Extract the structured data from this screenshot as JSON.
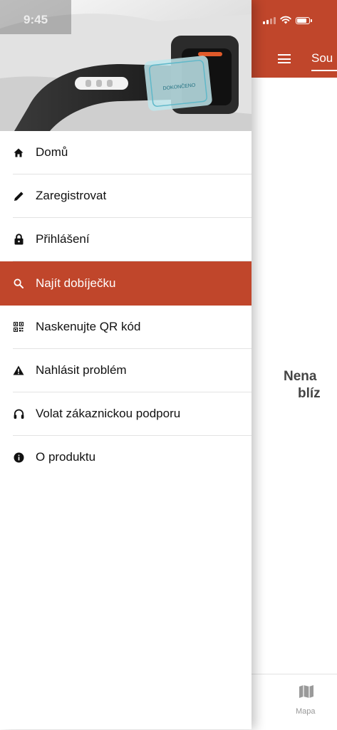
{
  "status_bar": {
    "time": "9:45"
  },
  "drawer": {
    "hero_screen_text": "DOKONČENO",
    "menu_items": [
      {
        "label": "Domů",
        "icon": "home-icon",
        "active": false
      },
      {
        "label": "Zaregistrovat",
        "icon": "pencil-icon",
        "active": false
      },
      {
        "label": "Přihlášení",
        "icon": "lock-icon",
        "active": false
      },
      {
        "label": "Najít dobíječku",
        "icon": "search-icon",
        "active": true
      },
      {
        "label": "Naskenujte QR kód",
        "icon": "qr-code-icon",
        "active": false
      },
      {
        "label": "Nahlásit problém",
        "icon": "warning-icon",
        "active": false
      },
      {
        "label": "Volat zákaznickou podporu",
        "icon": "headset-icon",
        "active": false
      },
      {
        "label": "O produktu",
        "icon": "info-icon",
        "active": false
      }
    ]
  },
  "main": {
    "tab_label": "Sou",
    "empty_message": [
      "Nena",
      "blíz"
    ],
    "bottom_nav": {
      "map_label": "Mapa"
    }
  },
  "colors": {
    "accent": "#c0462b",
    "text": "#111111",
    "divider": "#e3e3e3"
  }
}
